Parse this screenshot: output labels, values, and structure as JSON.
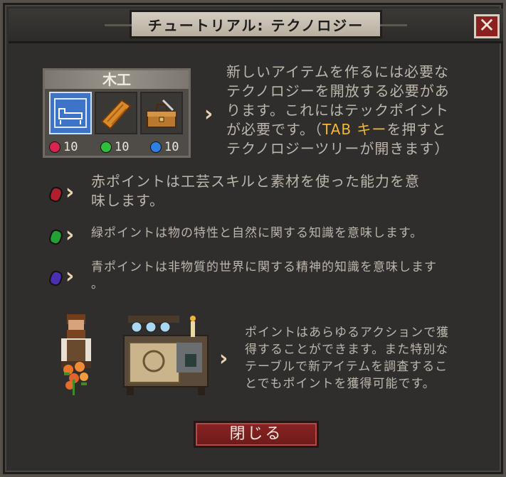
{
  "title": "チュートリアル: テクノロジー",
  "close_symbol": "✕",
  "tech_card": {
    "name": "木工",
    "points": [
      {
        "color": "#d8244f",
        "value": "10"
      },
      {
        "color": "#2fbf3a",
        "value": "10"
      },
      {
        "color": "#2f7fe6",
        "value": "10"
      }
    ],
    "icons": [
      "blueprint-bed-icon",
      "wood-plank-icon",
      "toolbox-icon"
    ]
  },
  "intro": {
    "line1": "新しいアイテムを作るには必要な",
    "line2": "テクノロジーを開放する必要があ",
    "line3": "ります。これにはテックポイント",
    "line4_pre": "が必要です。（",
    "line4_key": "TAB キー",
    "line4_post": "を押すと",
    "line5": "テクノロジーツリーが開きます）"
  },
  "red_point": {
    "gem_color": "#b0202c",
    "line1": "赤ポイントは工芸スキルと素材を使った能力を意",
    "line2": "味します。"
  },
  "green_point": {
    "gem_color": "#23a135",
    "text": "緑ポイントは物の特性と自然に関する知識を意味します。"
  },
  "blue_point": {
    "gem_color": "#4a2fb0",
    "line1": "青ポイントは非物質的世界に関する精神的知識を意味します",
    "line2": "。"
  },
  "earn_points": {
    "line1": "ポイントはあらゆるアクションで獲",
    "line2": "得することができます。また特別な",
    "line3": "テーブルで新アイテムを調査するこ",
    "line4": "とでもポイントを獲得可能です。"
  },
  "close_button": "閉じる"
}
